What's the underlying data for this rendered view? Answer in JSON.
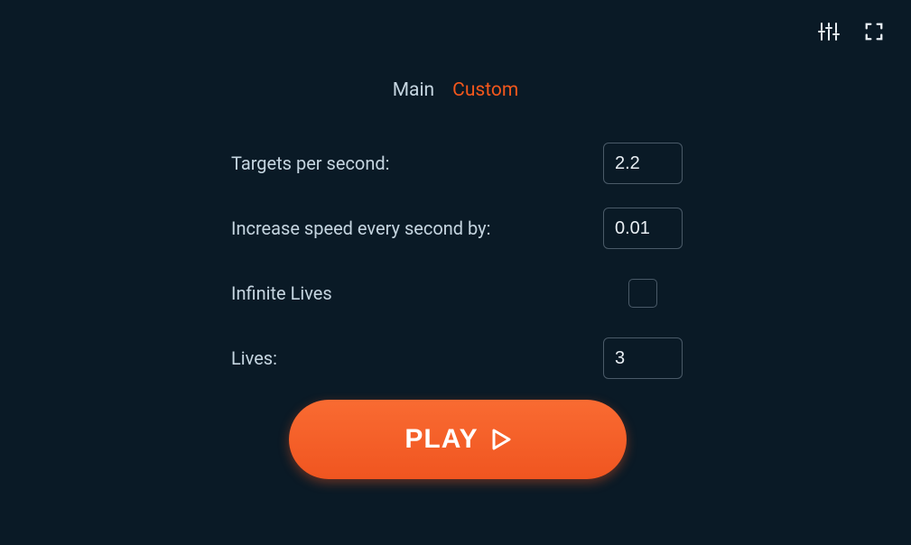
{
  "tabs": {
    "main": "Main",
    "custom": "Custom"
  },
  "settings": {
    "targets_per_second": {
      "label": "Targets per second:",
      "value": "2.2"
    },
    "increase_speed": {
      "label": "Increase speed every second by:",
      "value": "0.01"
    },
    "infinite_lives": {
      "label": "Infinite Lives",
      "checked": false
    },
    "lives": {
      "label": "Lives:",
      "value": "3"
    }
  },
  "play_button": {
    "label": "PLAY"
  },
  "colors": {
    "background": "#0a1a26",
    "text": "#c5d5e0",
    "accent": "#f2571c",
    "input_border": "#4a5a68"
  }
}
